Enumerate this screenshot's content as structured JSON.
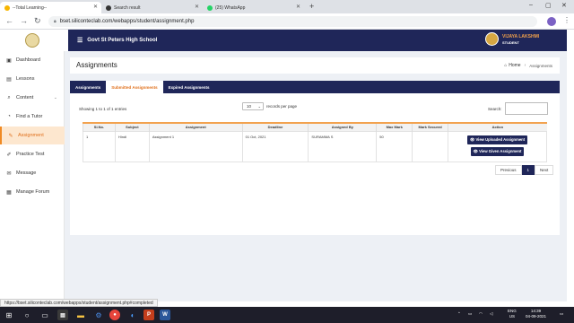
{
  "browser": {
    "tabs": [
      {
        "title": "--Total Learning--",
        "color": "#f7b500"
      },
      {
        "title": "Search result",
        "color": "#333333"
      },
      {
        "title": "(25) WhatsApp",
        "color": "#25d366"
      }
    ],
    "new_tab": "+",
    "url": "bset.siliconteclab.com/webapps/student/assignment.php",
    "status_url": "https://bset.siliconteclab.com/webapps/student/assignment.php#completed"
  },
  "header": {
    "school": "Govt St Peters High School",
    "user_name": "VIJAYA LAKSHMI",
    "user_role": "STUDENT"
  },
  "sidebar": {
    "items": [
      {
        "label": "Dashboard",
        "icon": "dashboard-icon",
        "glyph": "▣"
      },
      {
        "label": "Lessons",
        "icon": "book-icon",
        "glyph": "▤"
      },
      {
        "label": "Content",
        "icon": "search-icon",
        "glyph": "⌕"
      },
      {
        "label": "Find a Tutor",
        "icon": "user-icon",
        "glyph": "◔"
      },
      {
        "label": "Assignment",
        "icon": "pencil-icon",
        "glyph": "✎"
      },
      {
        "label": "Practice Test",
        "icon": "edit-icon",
        "glyph": "✐"
      },
      {
        "label": "Message",
        "icon": "envelope-icon",
        "glyph": "✉"
      },
      {
        "label": "Manage Forum",
        "icon": "forum-icon",
        "glyph": "▦"
      }
    ]
  },
  "page": {
    "title": "Assignments",
    "breadcrumb_home": "Home",
    "breadcrumb_current": "Assignments",
    "tabs": [
      "Assignments",
      "Submitted Assignments",
      "Expired Assignments"
    ],
    "showing": "Showing 1 to 1 of 1 entries",
    "length_value": "10",
    "length_label": "records per page",
    "search_label": "Search:",
    "columns": [
      "Sl.No.",
      "Subject",
      "Assignment",
      "Deadline",
      "Assigned By",
      "Max Mark",
      "Mark Secured",
      "Action"
    ],
    "rows": [
      {
        "sl": "1",
        "subject": "Hindi",
        "assignment": "Assignment 1",
        "deadline": "01 Oct, 2021",
        "assigned_by": "SURAMMA S",
        "max_mark": "50",
        "mark_secured": ""
      }
    ],
    "btn_view_uploaded": "View Uploaded Assignment",
    "btn_view_given": "View Given Assignment",
    "pager_prev": "Previous",
    "pager_page": "1",
    "pager_next": "Next"
  },
  "taskbar": {
    "lang_top": "ENG",
    "lang_bottom": "US",
    "time": "14:39",
    "date": "04-09-2021"
  }
}
